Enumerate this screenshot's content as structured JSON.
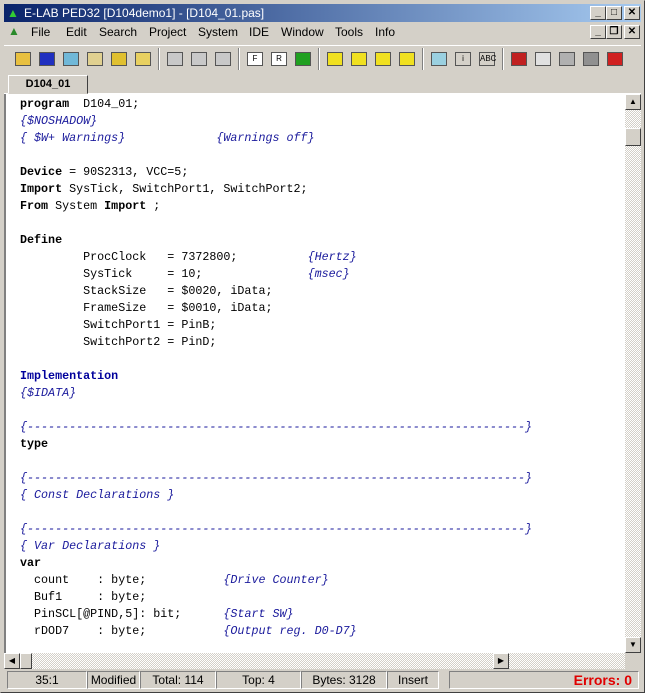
{
  "window": {
    "title": "E-LAB PED32 [D104demo1] - [D104_01.pas]"
  },
  "menu": [
    "File",
    "Edit",
    "Search",
    "Project",
    "System",
    "IDE",
    "Window",
    "Tools",
    "Info"
  ],
  "toolbar": [
    {
      "name": "open-folder",
      "color": "#e8c040"
    },
    {
      "name": "save",
      "color": "#2030c0"
    },
    {
      "name": "print",
      "color": "#70b8d8"
    },
    {
      "name": "copy-files",
      "color": "#e0d090"
    },
    {
      "name": "keys",
      "color": "#e0c030"
    },
    {
      "name": "new-folder-add",
      "color": "#e8d060"
    },
    {
      "sep": true
    },
    {
      "name": "cut",
      "color": "#c8c8c8"
    },
    {
      "name": "copy",
      "color": "#c8c8c8"
    },
    {
      "name": "paste",
      "color": "#c8c8c8"
    },
    {
      "sep": true
    },
    {
      "name": "find",
      "color": "#ffffff",
      "label": "F"
    },
    {
      "name": "replace",
      "color": "#ffffff",
      "label": "R"
    },
    {
      "name": "undo",
      "color": "#20a020"
    },
    {
      "sep": true
    },
    {
      "name": "block-1",
      "color": "#f0e020"
    },
    {
      "name": "block-2",
      "color": "#f0e020"
    },
    {
      "name": "block-3",
      "color": "#f0e020"
    },
    {
      "name": "block-4",
      "color": "#f0e020"
    },
    {
      "sep": true
    },
    {
      "name": "calculator",
      "color": "#9ad0e0"
    },
    {
      "name": "info",
      "color": "#d4d0c8",
      "label": "i"
    },
    {
      "name": "spellcheck",
      "color": "#d4d0c8",
      "label": "ABC"
    },
    {
      "sep": true
    },
    {
      "name": "hammer-build",
      "color": "#c02020"
    },
    {
      "name": "filter",
      "color": "#e0e0e0"
    },
    {
      "name": "wall",
      "color": "#b0b0b0"
    },
    {
      "name": "device",
      "color": "#909090"
    },
    {
      "name": "bug-debug",
      "color": "#d02020"
    }
  ],
  "tabs": [
    {
      "label": "D104_01"
    }
  ],
  "code": [
    [
      [
        "kw",
        "program"
      ],
      [
        "",
        "  D104_01;"
      ]
    ],
    [
      [
        "cm",
        "{$NOSHADOW}"
      ]
    ],
    [
      [
        "cm",
        "{ $W+ Warnings}             {Warnings off}"
      ]
    ],
    [],
    [
      [
        "kw",
        "Device"
      ],
      [
        "",
        " = 90S2313, VCC=5;"
      ]
    ],
    [
      [
        "kw",
        "Import"
      ],
      [
        "",
        " SysTick, SwitchPort1, SwitchPort2;"
      ]
    ],
    [
      [
        "kw",
        "From"
      ],
      [
        "",
        " System "
      ],
      [
        "kw",
        "Import"
      ],
      [
        "",
        " ;"
      ]
    ],
    [],
    [
      [
        "kw",
        "Define"
      ]
    ],
    [
      [
        "",
        "         ProcClock   = 7372800;          "
      ],
      [
        "cm",
        "{Hertz}"
      ]
    ],
    [
      [
        "",
        "         SysTick     = 10;               "
      ],
      [
        "cm",
        "{msec}"
      ]
    ],
    [
      [
        "",
        "         StackSize   = $0020, iData;"
      ]
    ],
    [
      [
        "",
        "         FrameSize   = $0010, iData;"
      ]
    ],
    [
      [
        "",
        "         SwitchPort1 = PinB;"
      ]
    ],
    [
      [
        "",
        "         SwitchPort2 = PinD;"
      ]
    ],
    [],
    [
      [
        "kb",
        "Implementation"
      ]
    ],
    [
      [
        "cm",
        "{$IDATA}"
      ]
    ],
    [],
    [
      [
        "cm",
        "{-----------------------------------------------------------------------}"
      ]
    ],
    [
      [
        "kw",
        "type"
      ]
    ],
    [],
    [
      [
        "cm",
        "{-----------------------------------------------------------------------}"
      ]
    ],
    [
      [
        "cm",
        "{ Const Declarations }"
      ]
    ],
    [],
    [
      [
        "cm",
        "{-----------------------------------------------------------------------}"
      ]
    ],
    [
      [
        "cm",
        "{ Var Declarations }"
      ]
    ],
    [
      [
        "kw",
        "var"
      ]
    ],
    [
      [
        "",
        "  count    : byte;           "
      ],
      [
        "cm",
        "{Drive Counter}"
      ]
    ],
    [
      [
        "",
        "  Buf1     : byte;"
      ]
    ],
    [
      [
        "",
        "  PinSCL[@PIND,5]: bit;      "
      ],
      [
        "cm",
        "{Start SW}"
      ]
    ],
    [
      [
        "",
        "  rDOD7    : byte;           "
      ],
      [
        "cm",
        "{Output reg. D0-D7}"
      ]
    ]
  ],
  "status": {
    "position": "35:1",
    "modified": "Modified",
    "total": "Total: 114",
    "top": "Top: 4",
    "bytes": "Bytes: 3128",
    "mode": "Insert",
    "errors": "Errors: 0"
  }
}
